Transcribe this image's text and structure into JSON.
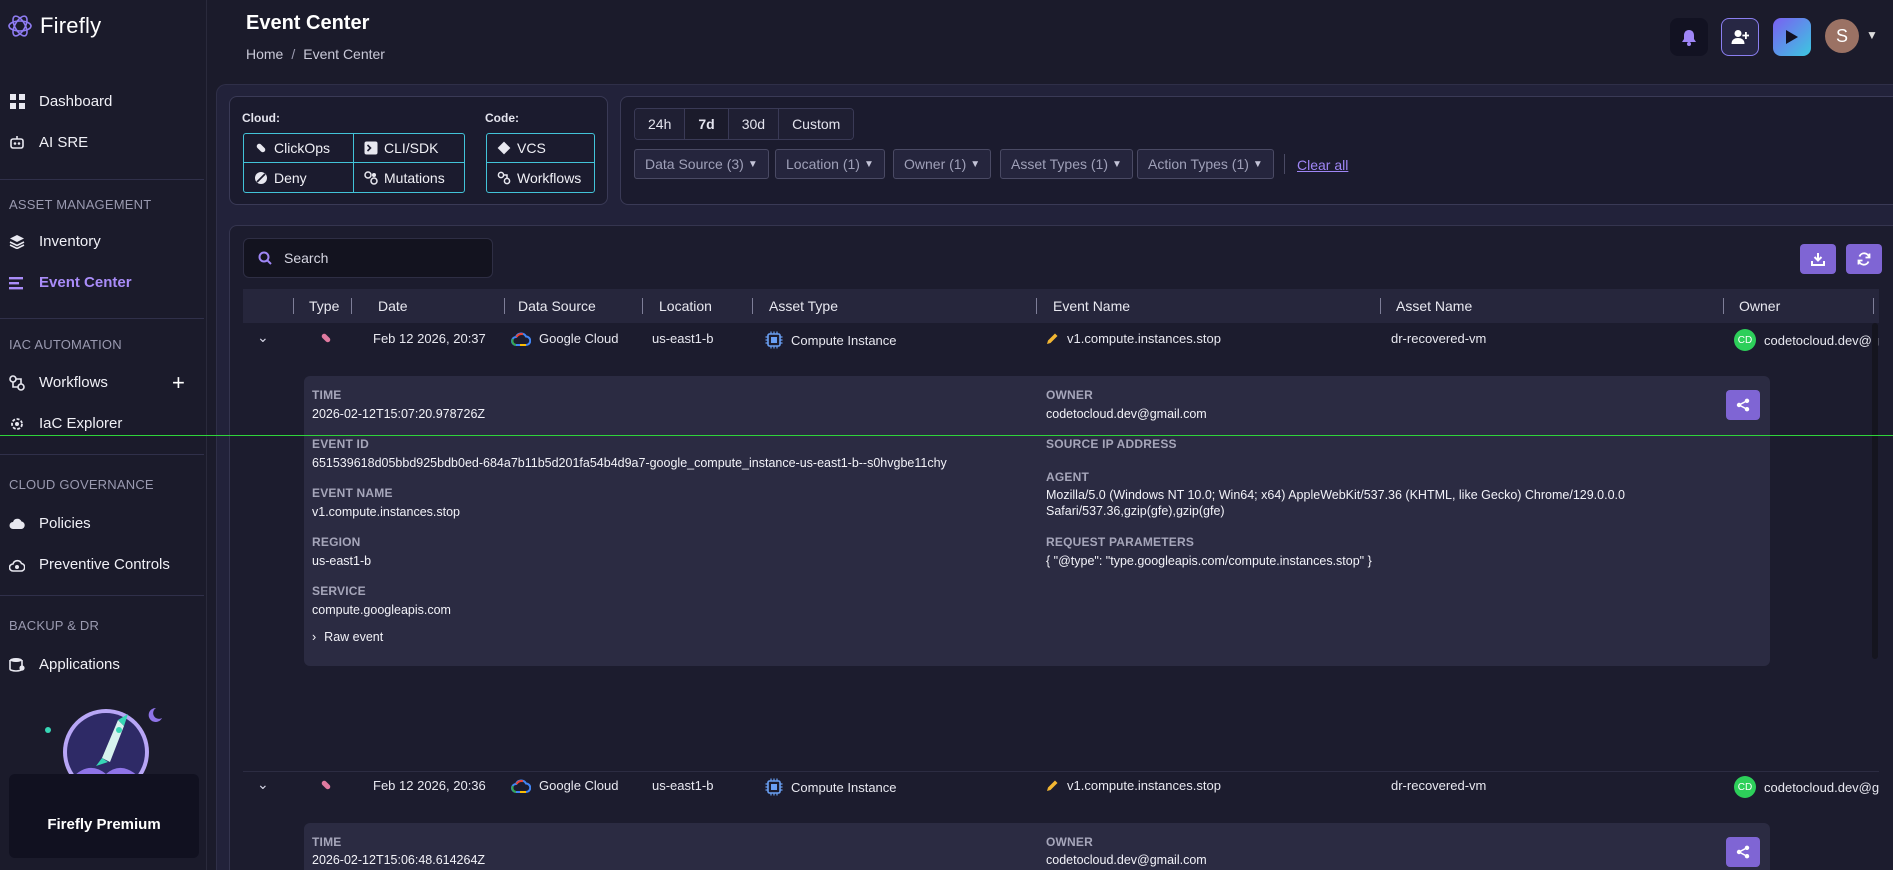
{
  "app": {
    "name": "Firefly"
  },
  "sidebar": {
    "items": [
      {
        "label": "Dashboard"
      },
      {
        "label": "AI SRE"
      },
      {
        "label": "Inventory"
      },
      {
        "label": "Event Center"
      },
      {
        "label": "Workflows"
      },
      {
        "label": "IaC Explorer"
      },
      {
        "label": "Policies"
      },
      {
        "label": "Preventive Controls"
      },
      {
        "label": "Applications"
      }
    ],
    "sections": [
      "ASSET MANAGEMENT",
      "IAC AUTOMATION",
      "CLOUD GOVERNANCE",
      "BACKUP & DR"
    ],
    "premium_label": "Firefly Premium"
  },
  "header": {
    "title": "Event Center",
    "breadcrumb": [
      "Home",
      "Event Center"
    ],
    "avatar_initial": "S"
  },
  "filters": {
    "cloud_label": "Cloud:",
    "code_label": "Code:",
    "cloud_types": [
      "ClickOps",
      "CLI/SDK",
      "Deny",
      "Mutations"
    ],
    "code_types": [
      "VCS",
      "Workflows"
    ],
    "time_ranges": [
      "24h",
      "7d",
      "30d",
      "Custom"
    ],
    "selected_time_range": "7d",
    "dropdowns": [
      "Data Source (3)",
      "Location (1)",
      "Owner (1)",
      "Asset Types (1)",
      "Action Types (1)"
    ],
    "clear_all": "Clear all"
  },
  "search": {
    "placeholder": "Search"
  },
  "table": {
    "columns": [
      "Type",
      "Date",
      "Data Source",
      "Location",
      "Asset Type",
      "Event Name",
      "Asset Name",
      "Owner"
    ],
    "rows": [
      {
        "date": "Feb 12 2026, 20:37",
        "data_source": "Google Cloud",
        "location": "us-east1-b",
        "asset_type": "Compute Instance",
        "event_name": "v1.compute.instances.stop",
        "asset_name": "dr-recovered-vm",
        "owner_initials": "CD",
        "owner": "codetocloud.dev@g"
      },
      {
        "date": "Feb 12 2026, 20:36",
        "data_source": "Google Cloud",
        "location": "us-east1-b",
        "asset_type": "Compute Instance",
        "event_name": "v1.compute.instances.stop",
        "asset_name": "dr-recovered-vm",
        "owner_initials": "CD",
        "owner": "codetocloud.dev@g"
      }
    ]
  },
  "details": [
    {
      "time_label": "TIME",
      "time": "2026-02-12T15:07:20.978726Z",
      "event_id_label": "EVENT ID",
      "event_id": "651539618d05bbd925bdb0ed-684a7b11b5d201fa54b4d9a7-google_compute_instance-us-east1-b--s0hvgbe11chy",
      "event_name_label": "EVENT NAME",
      "event_name": "v1.compute.instances.stop",
      "region_label": "REGION",
      "region": "us-east1-b",
      "service_label": "SERVICE",
      "service": "compute.googleapis.com",
      "raw_event": "Raw event",
      "owner_label": "OWNER",
      "owner": "codetocloud.dev@gmail.com",
      "source_ip_label": "SOURCE IP ADDRESS",
      "agent_label": "AGENT",
      "agent_line1": "Mozilla/5.0 (Windows NT 10.0; Win64; x64) AppleWebKit/537.36 (KHTML, like Gecko) Chrome/129.0.0.0",
      "agent_line2": "Safari/537.36,gzip(gfe),gzip(gfe)",
      "request_params_label": "REQUEST PARAMETERS",
      "request_params": "{ \"@type\": \"type.googleapis.com/compute.instances.stop\" }"
    },
    {
      "time_label": "TIME",
      "time": "2026-02-12T15:06:48.614264Z",
      "owner_label": "OWNER",
      "owner": "codetocloud.dev@gmail.com"
    }
  ],
  "colors": {
    "accent": "#a98cf8",
    "button": "#7f65d4",
    "type_border": "#42c3d8",
    "owner_badge": "#2dcf5a"
  },
  "icons": [
    "bell-icon",
    "add-user-icon",
    "play-icon",
    "download-icon",
    "refresh-icon",
    "share-icon",
    "search-icon"
  ]
}
